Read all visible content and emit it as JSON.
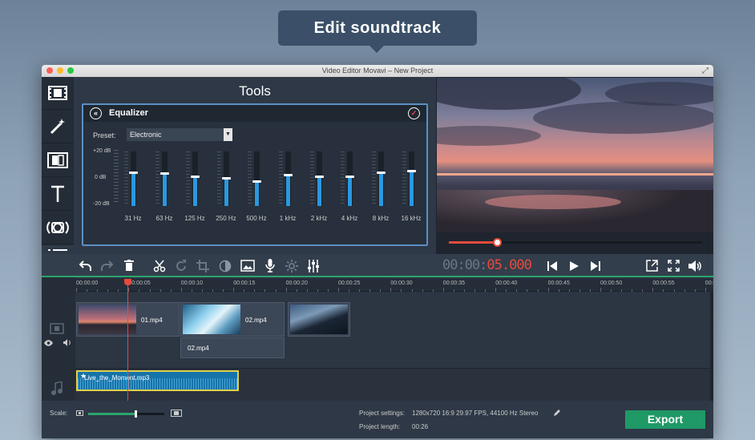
{
  "callout": {
    "title": "Edit soundtrack"
  },
  "window": {
    "title": "Video Editor Movavi – New Project"
  },
  "tools": {
    "title": "Tools",
    "equalizer": {
      "title": "Equalizer",
      "preset_label": "Preset:",
      "preset_value": "Electronic",
      "db_labels": [
        "+20 dB",
        "0 dB",
        "-20 dB"
      ],
      "bands": [
        {
          "freq": "31 Hz",
          "level": 0.62
        },
        {
          "freq": "63 Hz",
          "level": 0.6
        },
        {
          "freq": "125 Hz",
          "level": 0.55
        },
        {
          "freq": "250 Hz",
          "level": 0.52
        },
        {
          "freq": "500 Hz",
          "level": 0.46
        },
        {
          "freq": "1 kHz",
          "level": 0.58
        },
        {
          "freq": "2 kHz",
          "level": 0.55
        },
        {
          "freq": "4 kHz",
          "level": 0.55
        },
        {
          "freq": "8 kHz",
          "level": 0.62
        },
        {
          "freq": "16 kHz",
          "level": 0.64
        }
      ]
    }
  },
  "player": {
    "progress": 0.19,
    "timecode_dim": "00:00:",
    "timecode_active": "05.000"
  },
  "ruler": {
    "labels": [
      "00:00:00",
      "00:00:05",
      "00:00:10",
      "00:00:15",
      "00:00:20",
      "00:00:25",
      "00:00:30",
      "00:00:35",
      "00:00:40",
      "00:00:45",
      "00:00:50",
      "00:00:55",
      "00:0"
    ]
  },
  "timeline": {
    "clips": [
      "01.mp4",
      "02.mp4"
    ],
    "clip_lower": "02.mp4",
    "audio_clip": "Live_the_Moment.mp3"
  },
  "bottom": {
    "scale_label": "Scale:",
    "settings_label": "Project settings:",
    "settings_value": "1280x720 16:9 29.97 FPS, 44100 Hz Stereo",
    "length_label": "Project length:",
    "length_value": "00:26",
    "export_label": "Export"
  },
  "colors": {
    "accent": "#2a98e0",
    "timecode": "#e74a3b",
    "export": "#1f9966"
  }
}
